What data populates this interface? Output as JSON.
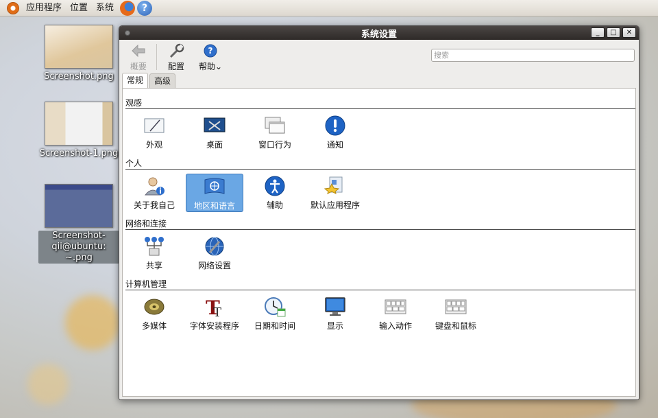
{
  "top_panel": {
    "menus": [
      "应用程序",
      "位置",
      "系统"
    ]
  },
  "desktop": {
    "icons": [
      {
        "label": "Screenshot.png"
      },
      {
        "label": "Screenshot-1.png"
      },
      {
        "label": "Screenshot-qii@ubuntu: ~.png"
      }
    ]
  },
  "window": {
    "title": "系统设置",
    "toolbar": {
      "overview": "概要",
      "configure": "配置",
      "help": "帮助"
    },
    "search": {
      "placeholder": "搜索",
      "value": ""
    },
    "tabs": [
      "常规",
      "高级"
    ],
    "active_tab": "常规",
    "sections": [
      {
        "title": "观感",
        "items": [
          {
            "label": "外观",
            "icon": "appearance-icon"
          },
          {
            "label": "桌面",
            "icon": "desktop-icon"
          },
          {
            "label": "窗口行为",
            "icon": "window-behavior-icon"
          },
          {
            "label": "通知",
            "icon": "notification-icon"
          }
        ]
      },
      {
        "title": "个人",
        "items": [
          {
            "label": "关于我自己",
            "icon": "user-info-icon"
          },
          {
            "label": "地区和语言",
            "icon": "globe-flag-icon",
            "selected": true
          },
          {
            "label": "辅助",
            "icon": "accessibility-icon"
          },
          {
            "label": "默认应用程序",
            "icon": "default-apps-icon"
          }
        ]
      },
      {
        "title": "网络和连接",
        "items": [
          {
            "label": "共享",
            "icon": "sharing-icon"
          },
          {
            "label": "网络设置",
            "icon": "network-globe-icon"
          }
        ]
      },
      {
        "title": "计算机管理",
        "items": [
          {
            "label": "多媒体",
            "icon": "speaker-icon"
          },
          {
            "label": "字体安装程序",
            "icon": "font-icon"
          },
          {
            "label": "日期和时间",
            "icon": "clock-icon"
          },
          {
            "label": "显示",
            "icon": "monitor-icon"
          },
          {
            "label": "输入动作",
            "icon": "keyboard-icon"
          },
          {
            "label": "键盘和鼠标",
            "icon": "keyboard-icon"
          }
        ]
      }
    ]
  },
  "colors": {
    "selection": "#6aa7e4",
    "titlebar": "#3b3634",
    "accent_orange": "#e06c16"
  }
}
